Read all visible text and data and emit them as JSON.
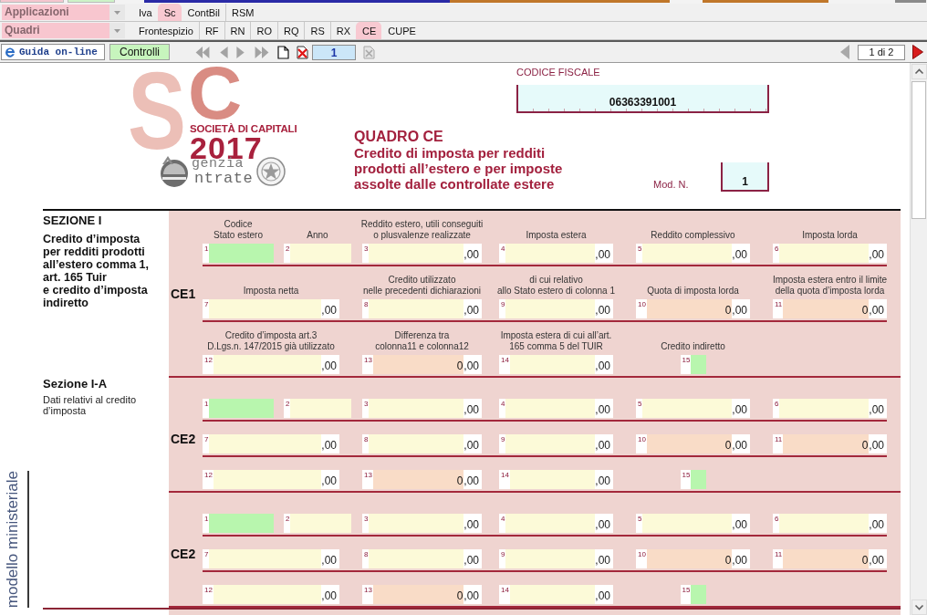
{
  "menus": [
    {
      "selector": "Applicazioni",
      "tabs": [
        {
          "label": "Iva",
          "selected": false
        },
        {
          "label": "Sc",
          "selected": true
        },
        {
          "label": "ContBil",
          "selected": false
        },
        {
          "label": "RSM",
          "selected": false
        }
      ]
    },
    {
      "selector": "Quadri",
      "tabs": [
        {
          "label": "Frontespizio",
          "selected": false
        },
        {
          "label": "RF",
          "selected": false
        },
        {
          "label": "RN",
          "selected": false
        },
        {
          "label": "RO",
          "selected": false
        },
        {
          "label": "RQ",
          "selected": false
        },
        {
          "label": "RS",
          "selected": false
        },
        {
          "label": "RX",
          "selected": false
        },
        {
          "label": "CE",
          "selected": true
        },
        {
          "label": "CUPE",
          "selected": false
        }
      ]
    }
  ],
  "toolbar": {
    "help_button": "Guida on-line",
    "checks_button": "Controlli",
    "page_field": "1",
    "pager": "1 di 2"
  },
  "header": {
    "logo": {
      "monogram": [
        "S",
        "C"
      ],
      "title": "SOCIETÀ DI CAPITALI",
      "year": "2017",
      "agency_lines": [
        "genzia",
        "ntrate"
      ]
    },
    "fiscal_code": {
      "label": "CODICE FISCALE",
      "value": "06363391001"
    },
    "quadro": {
      "title": "QUADRO CE",
      "subtitle": "Credito di imposta per redditi\nprodotti all’estero e per imposte\nassolte dalle controllate estere"
    },
    "module": {
      "label": "Mod. N.",
      "value": "1"
    }
  },
  "section": {
    "title": "SEZIONE I",
    "description": "Credito d’imposta\nper redditi prodotti\nall’estero comma 1,\nart. 165 Tuir\ne credito d’imposta\nindiretto"
  },
  "subsection": {
    "title": "Sezione I-A",
    "description": "Dati relativi al credito\nd’imposta"
  },
  "side_label": "modello ministeriale",
  "blocks": [
    {
      "code": "CE1",
      "rows": [
        [
          {
            "number": "1",
            "label": "Codice\nStato estero",
            "kind": "code"
          },
          {
            "number": "2",
            "label": "Anno",
            "kind": "text"
          },
          {
            "number": "3",
            "label": "Reddito estero, utili conseguiti\no plusvalenze realizzate",
            "kind": "amount",
            "cents": ",00"
          },
          {
            "number": "4",
            "label": "Imposta estera",
            "kind": "amount",
            "cents": ",00"
          },
          {
            "number": "5",
            "label": "Reddito complessivo",
            "kind": "amount",
            "cents": ",00"
          },
          {
            "number": "6",
            "label": "Imposta lorda",
            "kind": "amount",
            "cents": ",00"
          }
        ],
        [
          {
            "number": "7",
            "label": "Imposta netta",
            "kind": "amount",
            "cents": ",00",
            "colspan": 2
          },
          {
            "number": "8",
            "label": "Credito utilizzato\nnelle precedenti dichiarazioni",
            "kind": "amount",
            "cents": ",00"
          },
          {
            "number": "9",
            "label": "di cui relativo\nallo Stato estero di colonna 1",
            "kind": "amount",
            "cents": ",00"
          },
          {
            "number": "10",
            "label": "Quota di imposta lorda",
            "kind": "computed",
            "value": "0",
            "cents": ",00"
          },
          {
            "number": "11",
            "label": "Imposta estera entro il limite\ndella quota d’imposta lorda",
            "kind": "computed",
            "value": "0",
            "cents": ",00"
          }
        ],
        [
          {
            "number": "12",
            "label": "Credito d’imposta art.3\nD.Lgs.n. 147/2015 già utilizzato",
            "kind": "amount",
            "cents": ",00",
            "colspan": 2
          },
          {
            "number": "13",
            "label": "Differenza tra\ncolonna11 e colonna12",
            "kind": "computed",
            "value": "0",
            "cents": ",00"
          },
          {
            "number": "14",
            "label": "Imposta estera di cui all’art.\n165 comma 5 del TUIR",
            "kind": "amount",
            "cents": ",00"
          },
          {
            "number": "15",
            "label": "Credito indiretto",
            "kind": "flag"
          }
        ]
      ]
    },
    {
      "code": "CE2",
      "rows": [
        [
          {
            "number": "1",
            "kind": "code"
          },
          {
            "number": "2",
            "kind": "text"
          },
          {
            "number": "3",
            "kind": "amount",
            "cents": ",00"
          },
          {
            "number": "4",
            "kind": "amount",
            "cents": ",00"
          },
          {
            "number": "5",
            "kind": "amount",
            "cents": ",00"
          },
          {
            "number": "6",
            "kind": "amount",
            "cents": ",00"
          }
        ],
        [
          {
            "number": "7",
            "kind": "amount",
            "cents": ",00",
            "colspan": 2
          },
          {
            "number": "8",
            "kind": "amount",
            "cents": ",00"
          },
          {
            "number": "9",
            "kind": "amount",
            "cents": ",00"
          },
          {
            "number": "10",
            "kind": "computed",
            "value": "0",
            "cents": ",00"
          },
          {
            "number": "11",
            "kind": "computed",
            "value": "0",
            "cents": ",00"
          }
        ],
        [
          {
            "number": "12",
            "kind": "amount",
            "cents": ",00",
            "colspan": 2
          },
          {
            "number": "13",
            "kind": "computed",
            "value": "0",
            "cents": ",00"
          },
          {
            "number": "14",
            "kind": "amount",
            "cents": ",00"
          },
          {
            "number": "15",
            "kind": "flag"
          }
        ]
      ]
    },
    {
      "code": "CE2",
      "rows": [
        [
          {
            "number": "1",
            "kind": "code"
          },
          {
            "number": "2",
            "kind": "text"
          },
          {
            "number": "3",
            "kind": "amount",
            "cents": ",00"
          },
          {
            "number": "4",
            "kind": "amount",
            "cents": ",00"
          },
          {
            "number": "5",
            "kind": "amount",
            "cents": ",00"
          },
          {
            "number": "6",
            "kind": "amount",
            "cents": ",00"
          }
        ],
        [
          {
            "number": "7",
            "kind": "amount",
            "cents": ",00",
            "colspan": 2
          },
          {
            "number": "8",
            "kind": "amount",
            "cents": ",00"
          },
          {
            "number": "9",
            "kind": "amount",
            "cents": ",00"
          },
          {
            "number": "10",
            "kind": "computed",
            "value": "0",
            "cents": ",00"
          },
          {
            "number": "11",
            "kind": "computed",
            "value": "0",
            "cents": ",00"
          }
        ],
        [
          {
            "number": "12",
            "kind": "amount",
            "cents": ",00",
            "colspan": 2
          },
          {
            "number": "13",
            "kind": "computed",
            "value": "0",
            "cents": ",00"
          },
          {
            "number": "14",
            "kind": "amount",
            "cents": ",00"
          },
          {
            "number": "15",
            "kind": "flag"
          }
        ]
      ]
    }
  ]
}
